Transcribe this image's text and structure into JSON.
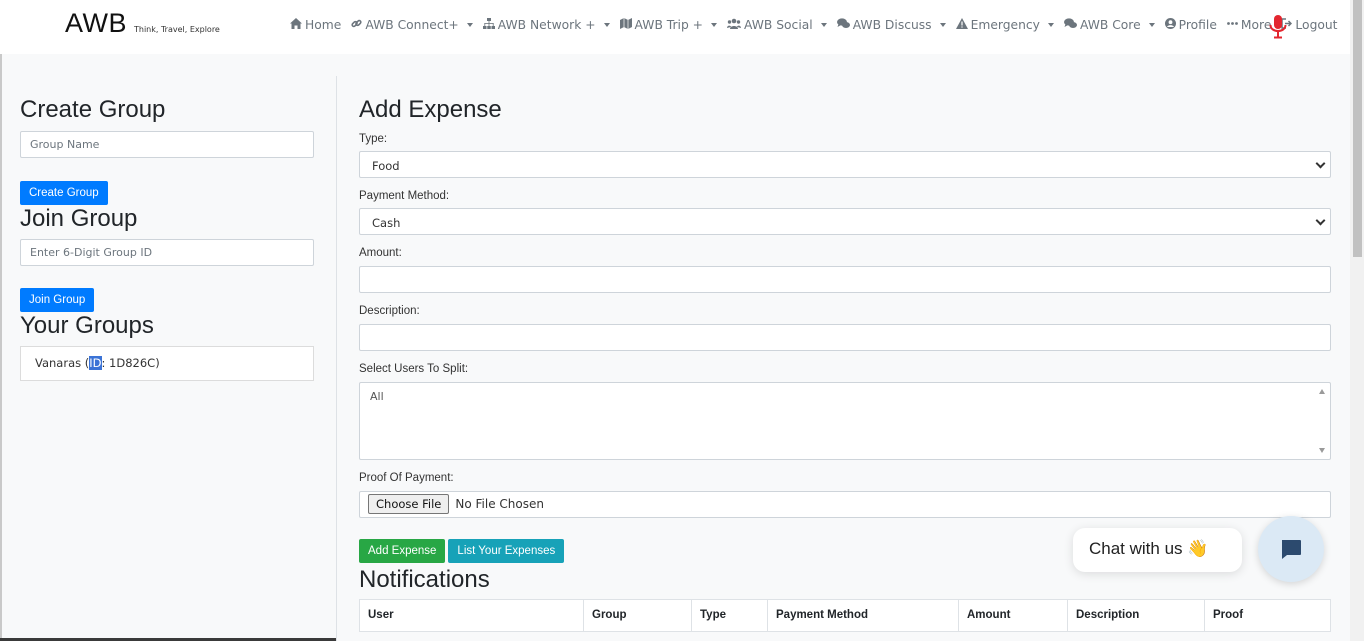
{
  "navbar": {
    "brand": "AWB",
    "tagline": "Think, Travel, Explore",
    "items": [
      {
        "label": "Home",
        "icon": "home-icon",
        "dropdown": false
      },
      {
        "label": "AWB Connect+",
        "icon": "link-icon",
        "dropdown": true
      },
      {
        "label": "AWB Network +",
        "icon": "sitemap-icon",
        "dropdown": true
      },
      {
        "label": "AWB Trip +",
        "icon": "map-icon",
        "dropdown": true
      },
      {
        "label": "AWB Social",
        "icon": "users-icon",
        "dropdown": true
      },
      {
        "label": "AWB Discuss",
        "icon": "comments-icon",
        "dropdown": true
      },
      {
        "label": "Emergency",
        "icon": "warning-icon",
        "dropdown": true
      },
      {
        "label": "AWB Core",
        "icon": "comments-icon",
        "dropdown": true
      },
      {
        "label": "Profile",
        "icon": "user-circle-icon",
        "dropdown": false
      },
      {
        "label": "More",
        "icon": "ellipsis-icon",
        "dropdown": false
      },
      {
        "label": "Logout",
        "icon": "logout-icon",
        "dropdown": false
      }
    ],
    "mic_color": "#e3262f"
  },
  "left": {
    "create_title": "Create Group",
    "group_name_placeholder": "Group Name",
    "create_button": "Create Group",
    "join_title": "Join Group",
    "group_id_placeholder": "Enter 6-Digit Group ID",
    "join_button": "Join Group",
    "your_groups_title": "Your Groups",
    "groups": [
      {
        "name_prefix": "Vanaras (",
        "highlight": "ID",
        "suffix": ": 1D826C)"
      }
    ]
  },
  "right": {
    "title": "Add Expense",
    "type_label": "Type:",
    "type_value": "Food",
    "payment_label": "Payment Method:",
    "payment_value": "Cash",
    "amount_label": "Amount:",
    "description_label": "Description:",
    "split_label": "Select Users To Split:",
    "split_options": [
      "All"
    ],
    "proof_label": "Proof Of Payment:",
    "file_button": "Choose File",
    "file_status": "No File Chosen",
    "add_button": "Add Expense",
    "list_button": "List Your Expenses",
    "notifications_title": "Notifications",
    "table_headers": [
      "User",
      "Group",
      "Type",
      "Payment Method",
      "Amount",
      "Description",
      "Proof"
    ]
  },
  "chat": {
    "label": "Chat with us",
    "emoji": "👋",
    "accent": "#2c4a6e"
  },
  "colors": {
    "primary": "#007bff",
    "success": "#28a745",
    "info": "#17a2b8"
  }
}
